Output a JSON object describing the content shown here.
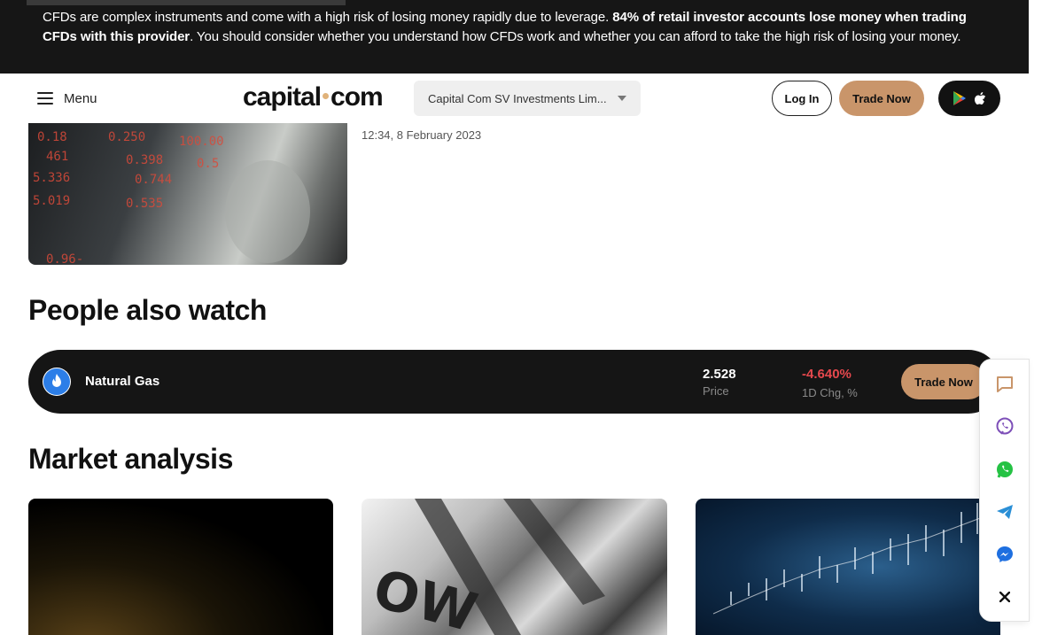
{
  "banner": {
    "text_1": "CFDs are complex instruments and come with a high risk of losing money rapidly due to leverage. ",
    "text_bold": "84% of retail investor accounts lose money when trading CFDs with this provider",
    "text_2": ". You should consider whether you understand how CFDs work and whether you can afford to take the high risk of losing your money."
  },
  "header": {
    "menu_label": "Menu",
    "logo_left": "capital",
    "logo_right": "com",
    "entity_select": "Capital Com SV Investments Lim...",
    "login_label": "Log In",
    "trade_label": "Trade Now"
  },
  "article": {
    "date": "12:34, 8 February 2023"
  },
  "people_also_watch": {
    "title": "People also watch",
    "instrument": {
      "name": "Natural Gas",
      "price": "2.528",
      "price_label": "Price",
      "change": "-4.640%",
      "change_label": "1D Chg, %",
      "trade_label": "Trade Now"
    }
  },
  "market_analysis": {
    "title": "Market analysis"
  },
  "social": {
    "items": [
      "chat-icon",
      "viber-icon",
      "whatsapp-icon",
      "telegram-icon",
      "messenger-icon",
      "close-icon"
    ],
    "colors": {
      "viber": "#7d4fb8",
      "whatsapp": "#25c244",
      "telegram": "#2a8fd6",
      "messenger": "#1e6fe0"
    }
  },
  "colors": {
    "accent": "#c9956a",
    "negative": "#e5484d",
    "dark": "#151515"
  }
}
